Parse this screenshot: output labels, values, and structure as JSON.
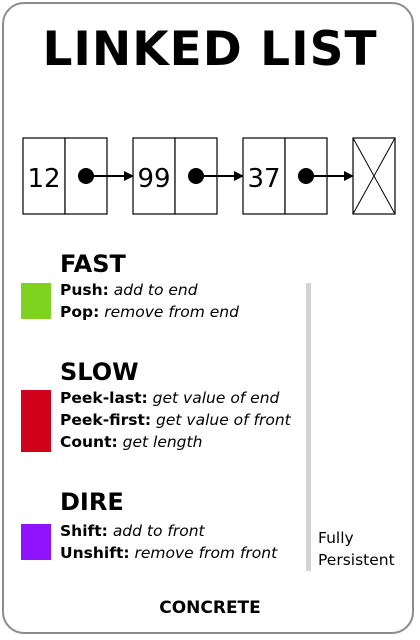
{
  "title": "LINKED LIST",
  "diagram": {
    "nodes": [
      {
        "value": "12"
      },
      {
        "value": "99"
      },
      {
        "value": "37"
      }
    ],
    "terminal": "null-node"
  },
  "sections": [
    {
      "title": "FAST",
      "color": "#7ed321",
      "operations": [
        {
          "name": "Push:",
          "desc": "add to end"
        },
        {
          "name": "Pop:",
          "desc": "remove from end"
        }
      ]
    },
    {
      "title": "SLOW",
      "color": "#d0021b",
      "operations": [
        {
          "name": "Peek-last:",
          "desc": "get value of end"
        },
        {
          "name": "Peek-first:",
          "desc": "get value of front"
        },
        {
          "name": "Count:",
          "desc": "get length"
        }
      ]
    },
    {
      "title": "DIRE",
      "color": "#9013fe",
      "operations": [
        {
          "name": "Shift:",
          "desc": "add to front"
        },
        {
          "name": "Unshift:",
          "desc": "remove from front"
        }
      ]
    }
  ],
  "persistence": {
    "line1": "Fully",
    "line2": "Persistent"
  },
  "footer": "CONCRETE"
}
